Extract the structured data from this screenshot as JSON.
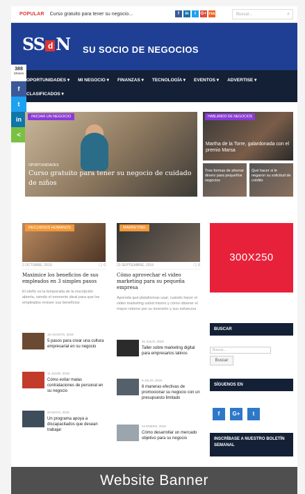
{
  "topbar": {
    "popular_label": "POPULAR",
    "ticker": "Curso gratuito para tener su negocio...",
    "social": [
      {
        "icon": "facebook-icon",
        "glyph": "f",
        "color": "#3b5998"
      },
      {
        "icon": "linkedin-icon",
        "glyph": "in",
        "color": "#0e76a8"
      },
      {
        "icon": "twitter-icon",
        "glyph": "t",
        "color": "#1da1f2"
      },
      {
        "icon": "google-plus-icon",
        "glyph": "G+",
        "color": "#dd4b39"
      },
      {
        "icon": "rss-icon",
        "glyph": "rss",
        "color": "#f26522"
      }
    ],
    "search_placeholder": "Buscar..."
  },
  "header": {
    "logo_left": "SS",
    "logo_mid": "d",
    "logo_right": "N",
    "tagline": "SU SOCIO DE NEGOCIOS",
    "bg_color": "#1e3f94"
  },
  "share_rail": {
    "count": "388",
    "count_label": "Shares"
  },
  "nav": {
    "row1": [
      "OPORTUNIDADES ▾",
      "MI NEGOCIO ▾",
      "FINANZAS ▾",
      "TECNOLOGÍA ▾",
      "EVENTOS ▾",
      "ADVERTISE ▾"
    ],
    "row2": [
      "CLASIFICADOS ▾"
    ]
  },
  "hero": {
    "tag": "INICIAR UN NEGOCIO",
    "category": "OPORTUNIDADES",
    "title": "Curso gratuito para tener su negocio de cuidado de niños"
  },
  "side_featured": {
    "tag": "HABLANDO DE NEGOCIOS",
    "title": "Martha de la Torre, galardonada con el premio Marsa",
    "small_1": "Tres formas de ahorrar dinero para pequeños negocios",
    "small_2": "Qué hacer si le negaron su solicitud de crédito"
  },
  "articles": [
    {
      "tag": "RECURSOS HUMANOS",
      "date": "2 OCTUBRE, 2019",
      "comments": "0",
      "title": "Maximice los beneficios de sus empleados en 3 simples pasos",
      "excerpt": "El otoño es la temporada de la inscripción abierta, siendo el momento ideal para que los empleados revisen sus beneficios"
    },
    {
      "tag": "MARKETING",
      "date": "23 SEPTIEMBRE, 2019",
      "comments": "0",
      "title": "Cómo aprovechar el video marketing para su pequeña empresa",
      "excerpt": "Aprenda qué plataformas usar, cuándo hacer el video marketing usted mismo y cómo obtener el mayor retorno por su inversión y sus esfuerzos"
    }
  ],
  "list_left": [
    {
      "date": "19 AGOSTO, 2019",
      "title": "5 pasos para crear una cultura empresarial en su negocio"
    },
    {
      "date": "11 JUNIO, 2019",
      "title": "Cómo evitar malas contrataciones de personal en su negocio"
    },
    {
      "date": "22 MAYO, 2019",
      "title": "Un programa apoya a discapacitados que desean trabajar"
    }
  ],
  "list_right": [
    {
      "date": "31 JULIO, 2019",
      "title": "Taller sobre marketing digital para empresarios latinos"
    },
    {
      "date": "9 JULIO, 2019",
      "title": "6 maneras efectivas de promocionar su negocio con un presupuesto limitado"
    },
    {
      "date": "24 ENERO, 2019",
      "title": "Cómo desarrollar un mercado objetivo para su negocio"
    }
  ],
  "sidebar": {
    "ad_label": "300X250",
    "search_heading": "BUSCAR",
    "search_placeholder": "Buscar...",
    "search_button": "Buscar",
    "follow_heading": "SÍGUENOS EN",
    "follow_icons": [
      {
        "icon": "facebook-icon",
        "glyph": "f"
      },
      {
        "icon": "google-plus-icon",
        "glyph": "G+"
      },
      {
        "icon": "twitter-icon",
        "glyph": "t"
      }
    ],
    "newsletter_heading": "INSCRÍBASE A NUESTRO BOLETÍN SEMANAL"
  },
  "caption": "Website  Banner",
  "colors": {
    "nav": "#132035",
    "accent_red": "#e8213a",
    "tag_purple": "#8a3bd6",
    "tag_orange": "#f39a3a"
  }
}
